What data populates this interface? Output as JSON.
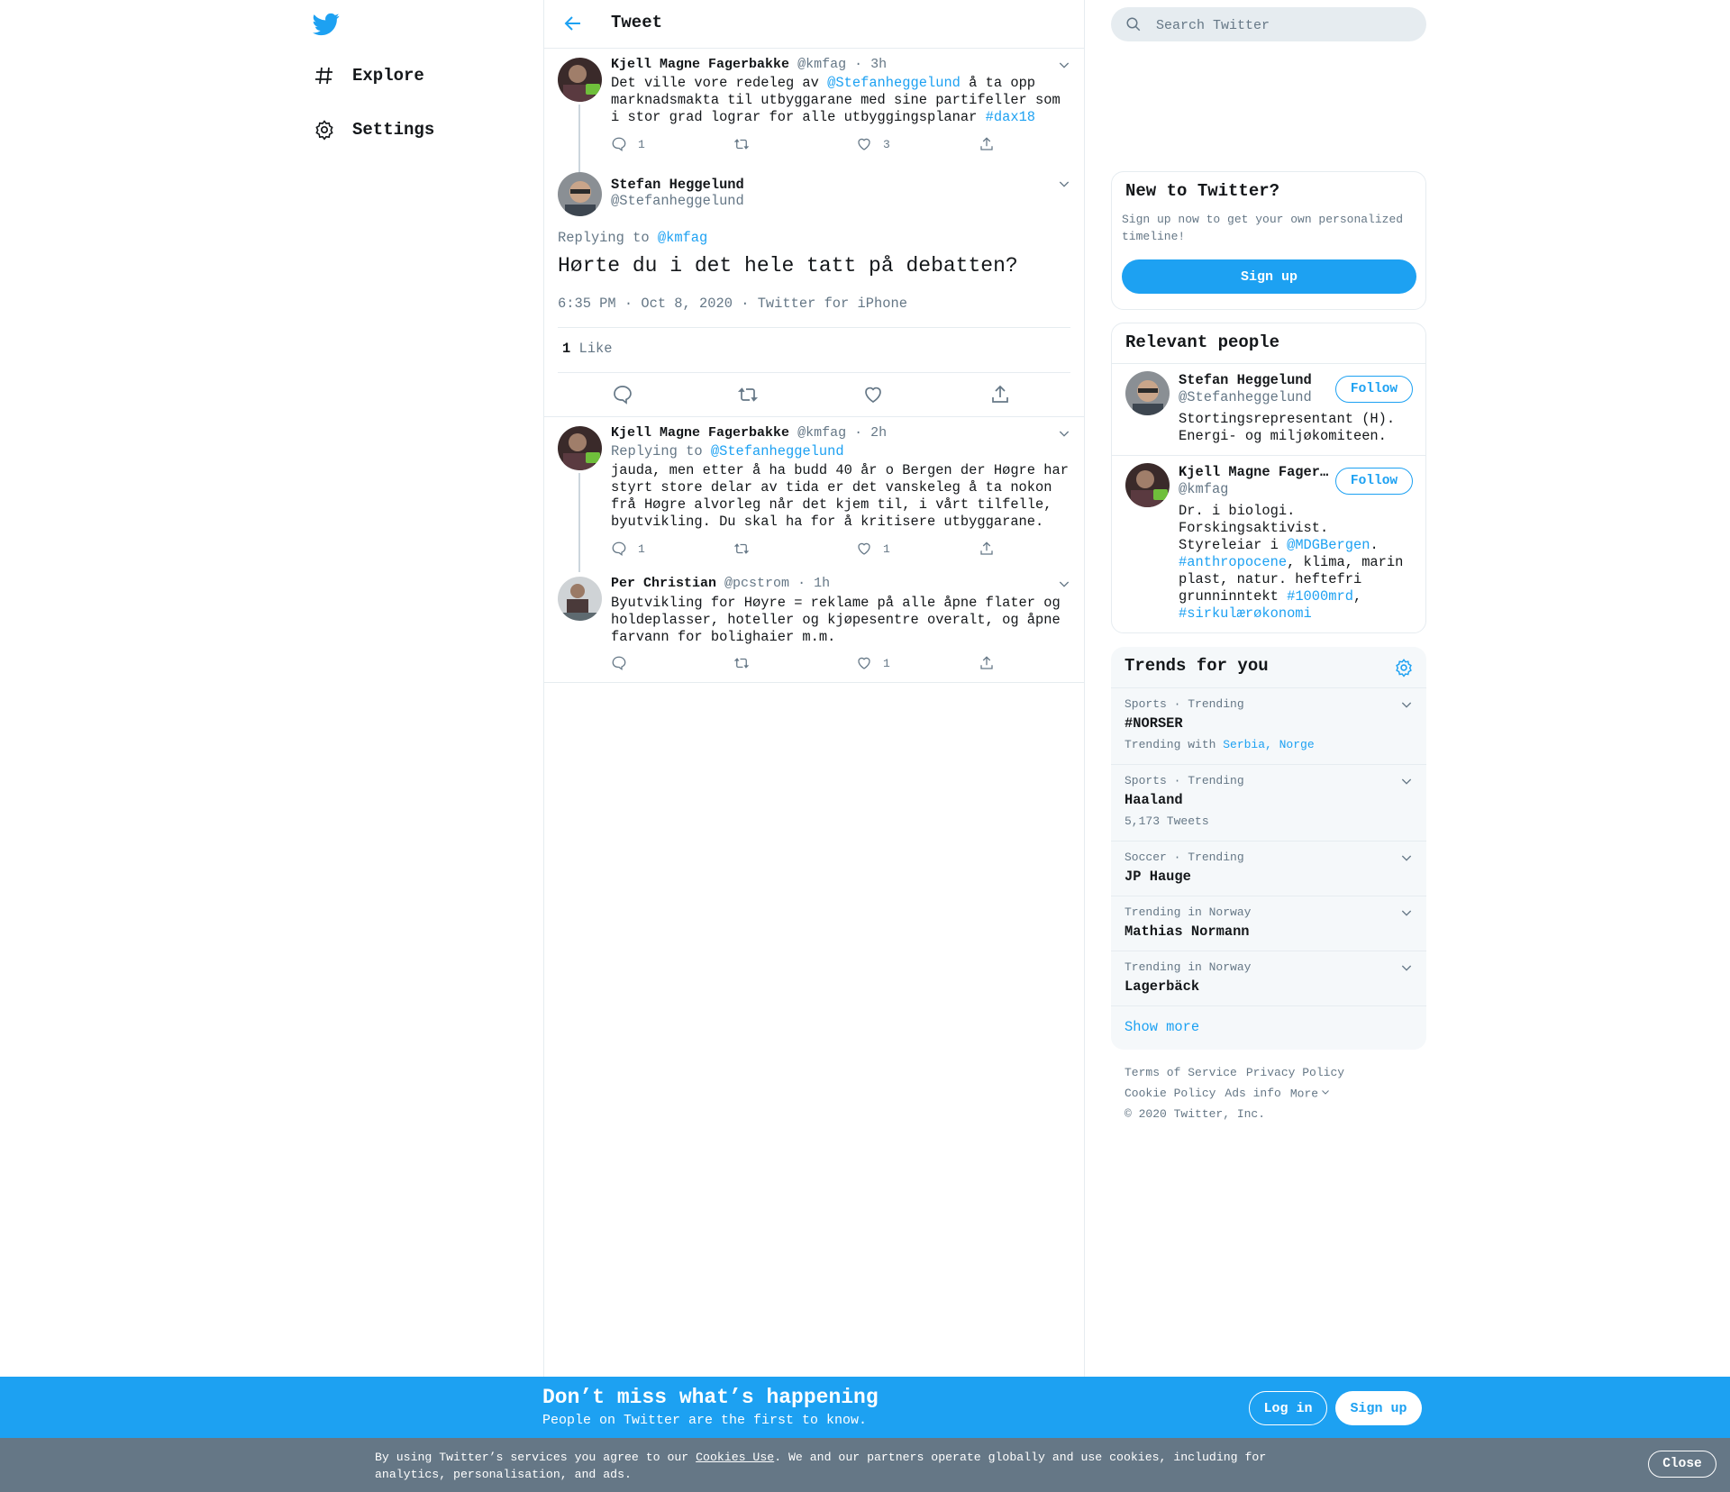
{
  "colors": {
    "accent": "#1da1f2",
    "muted": "#657786",
    "border": "#e6ecf0",
    "cookie_bg": "#657786"
  },
  "nav": {
    "logo_icon": "twitter-bird-icon",
    "items": [
      {
        "label": "Explore",
        "icon": "hashtag-icon"
      },
      {
        "label": "Settings",
        "icon": "gear-icon"
      }
    ]
  },
  "header": {
    "title": "Tweet",
    "back_icon": "arrow-left-icon"
  },
  "tweets": {
    "parent": {
      "name": "Kjell Magne Fagerbakke",
      "handle": "@kmfag",
      "time": "· 3h",
      "text_before": "Det ville vore redeleg av  ",
      "mention": "@Stefanheggelund",
      "text_after": " å ta opp marknadsmakta til utbyggarane med sine partifeller som i stor grad lograr for alle utbyggingsplanar ",
      "hashtag": "#dax18",
      "replies": "1",
      "retweets": "",
      "likes": "3"
    },
    "focus": {
      "name": "Stefan Heggelund",
      "handle": "@Stefanheggelund",
      "replying_label": "Replying to ",
      "replying_to": "@kmfag",
      "text": "Hørte du i det hele tatt på debatten?",
      "time": "6:35 PM · Oct 8, 2020",
      "sep": " · ",
      "source": "Twitter for iPhone",
      "like_count": "1",
      "like_label": "Like"
    },
    "reply1": {
      "name": "Kjell Magne Fagerbakke",
      "handle": "@kmfag",
      "time": "· 2h",
      "replying_label": "Replying to ",
      "replying_to": "@Stefanheggelund",
      "text": "jauda, men etter å ha budd 40 år o Bergen der Høgre har styrt store delar av tida er det vanskeleg å ta nokon frå Høgre alvorleg når det kjem til, i vårt tilfelle, byutvikling. Du skal ha for å kritisere utbyggarane.",
      "replies": "1",
      "retweets": "",
      "likes": "1"
    },
    "reply2": {
      "name": "Per Christian",
      "handle": "@pcstrom",
      "time": "· 1h",
      "text": "Byutvikling for Høyre = reklame på alle åpne flater og holdeplasser, hoteller og kjøpesentre overalt, og åpne farvann for bolighaier m.m.",
      "replies": "",
      "retweets": "",
      "likes": "1"
    }
  },
  "search": {
    "placeholder": "Search Twitter"
  },
  "new_to_twitter": {
    "title": "New to Twitter?",
    "text": "Sign up now to get your own personalized timeline!",
    "button": "Sign up"
  },
  "relevant_people": {
    "title": "Relevant people",
    "people": [
      {
        "name": "Stefan Heggelund",
        "handle": "@Stefanheggelund",
        "bio": "Stortingsrepresentant (H). Energi- og miljøkomiteen.",
        "follow": "Follow"
      },
      {
        "name": "Kjell Magne Fagerbakke",
        "handle": "@kmfag",
        "bio_1": "Dr. i biologi. Forskingsaktivist. Styreleiar i ",
        "bio_mention": "@MDGBergen",
        "bio_2": ". ",
        "bio_tag1": "#anthropocene",
        "bio_3": ", klima, marin plast, natur. heftefri grunninntekt ",
        "bio_tag2": "#1000mrd",
        "bio_4": ", ",
        "bio_tag3": "#sirkulærøkonomi",
        "follow": "Follow"
      }
    ]
  },
  "trends": {
    "title": "Trends for you",
    "items": [
      {
        "context": "Sports · Trending",
        "title": "#NORSER",
        "sub_label": "Trending with ",
        "sub_links": "Serbia, Norge"
      },
      {
        "context": "Sports · Trending",
        "title": "Haaland",
        "sub": "5,173 Tweets"
      },
      {
        "context": "Soccer · Trending",
        "title": "JP Hauge"
      },
      {
        "context": "Trending in Norway",
        "title": "Mathias Normann"
      },
      {
        "context": "Trending in Norway",
        "title": "Lagerbäck"
      }
    ],
    "show_more": "Show more"
  },
  "footer": {
    "terms": "Terms of Service",
    "privacy": "Privacy Policy",
    "cookie": "Cookie Policy",
    "ads": "Ads info",
    "more": "More",
    "copyright": "© 2020 Twitter, Inc."
  },
  "bottom_bar": {
    "title": "Don’t miss what’s happening",
    "subtitle": "People on Twitter are the first to know.",
    "login": "Log in",
    "signup": "Sign up"
  },
  "cookie_bar": {
    "text_1": "By using Twitter’s services you agree to our ",
    "link": "Cookies Use",
    "text_2": ". We and our partners operate globally and use cookies, including for analytics, personalisation, and ads.",
    "close": "Close"
  }
}
